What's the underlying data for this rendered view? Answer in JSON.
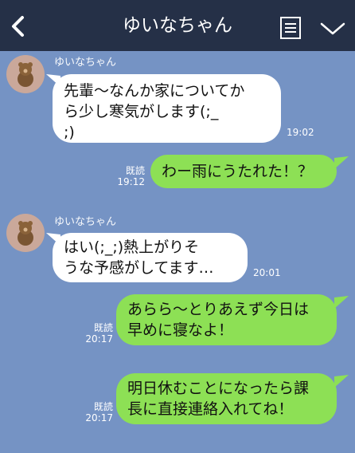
{
  "header": {
    "title": "ゆいなちゃん",
    "back_icon": "chevron-left-icon",
    "memo_icon": "notes-icon",
    "menu_icon": "chevron-down-icon"
  },
  "colors": {
    "header": "#253047",
    "background": "#7593c4",
    "incoming_bubble": "#ffffff",
    "outgoing_bubble": "#8de055"
  },
  "messages": [
    {
      "sender": "ゆいなちゃん",
      "lines": [
        "先輩〜なんか家についてか",
        "ら少し寒気がします(;_",
        ";)"
      ],
      "time": "19:02"
    },
    {
      "read": "既読",
      "time": "19:12",
      "lines": [
        "わー雨にうたれた！？"
      ]
    },
    {
      "sender": "ゆいなちゃん",
      "lines": [
        "はい(;_;)熱上がりそ",
        "うな予感がしてます…"
      ],
      "time": "20:01"
    },
    {
      "read": "既読",
      "time": "20:17",
      "lines": [
        "あらら〜とりあえず今日は",
        "早めに寝なよ！"
      ]
    },
    {
      "read": "既読",
      "time": "20:17",
      "lines": [
        "明日休むことになったら課",
        "長に直接連絡入れてね！"
      ]
    }
  ]
}
